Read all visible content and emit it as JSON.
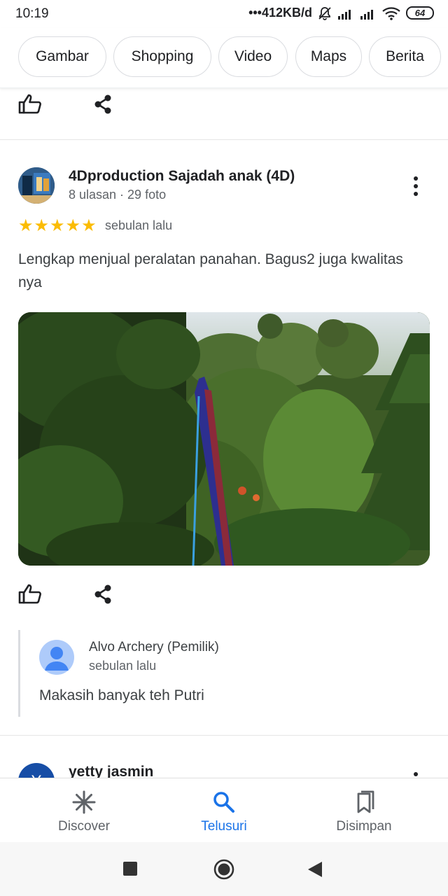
{
  "status_bar": {
    "time": "10:19",
    "network_speed": "•••412KB/d",
    "battery": "64"
  },
  "chips": [
    "Gambar",
    "Shopping",
    "Video",
    "Maps",
    "Berita"
  ],
  "review": {
    "reviewer_name": "4Dproduction Sajadah anak (4D)",
    "reviewer_meta": "8 ulasan · 29 foto",
    "rating": 5,
    "time": "sebulan lalu",
    "text": "Lengkap menjual peralatan panahan. Bagus2 juga kwalitas nya"
  },
  "owner_reply": {
    "name": "Alvo Archery (Pemilik)",
    "time": "sebulan lalu",
    "text": "Makasih banyak teh Putri"
  },
  "next_review": {
    "avatar_letter": "Y",
    "reviewer_name": "yetty jasmin"
  },
  "bottom_nav": {
    "items": [
      {
        "label": "Discover",
        "icon": "asterisk-icon",
        "active": false
      },
      {
        "label": "Telusuri",
        "icon": "search-icon",
        "active": true
      },
      {
        "label": "Disimpan",
        "icon": "bookmarks-icon",
        "active": false
      }
    ]
  },
  "colors": {
    "accent": "#1a73e8",
    "star": "#fbbc04",
    "text": "#202124",
    "secondary_text": "#5f6368"
  }
}
